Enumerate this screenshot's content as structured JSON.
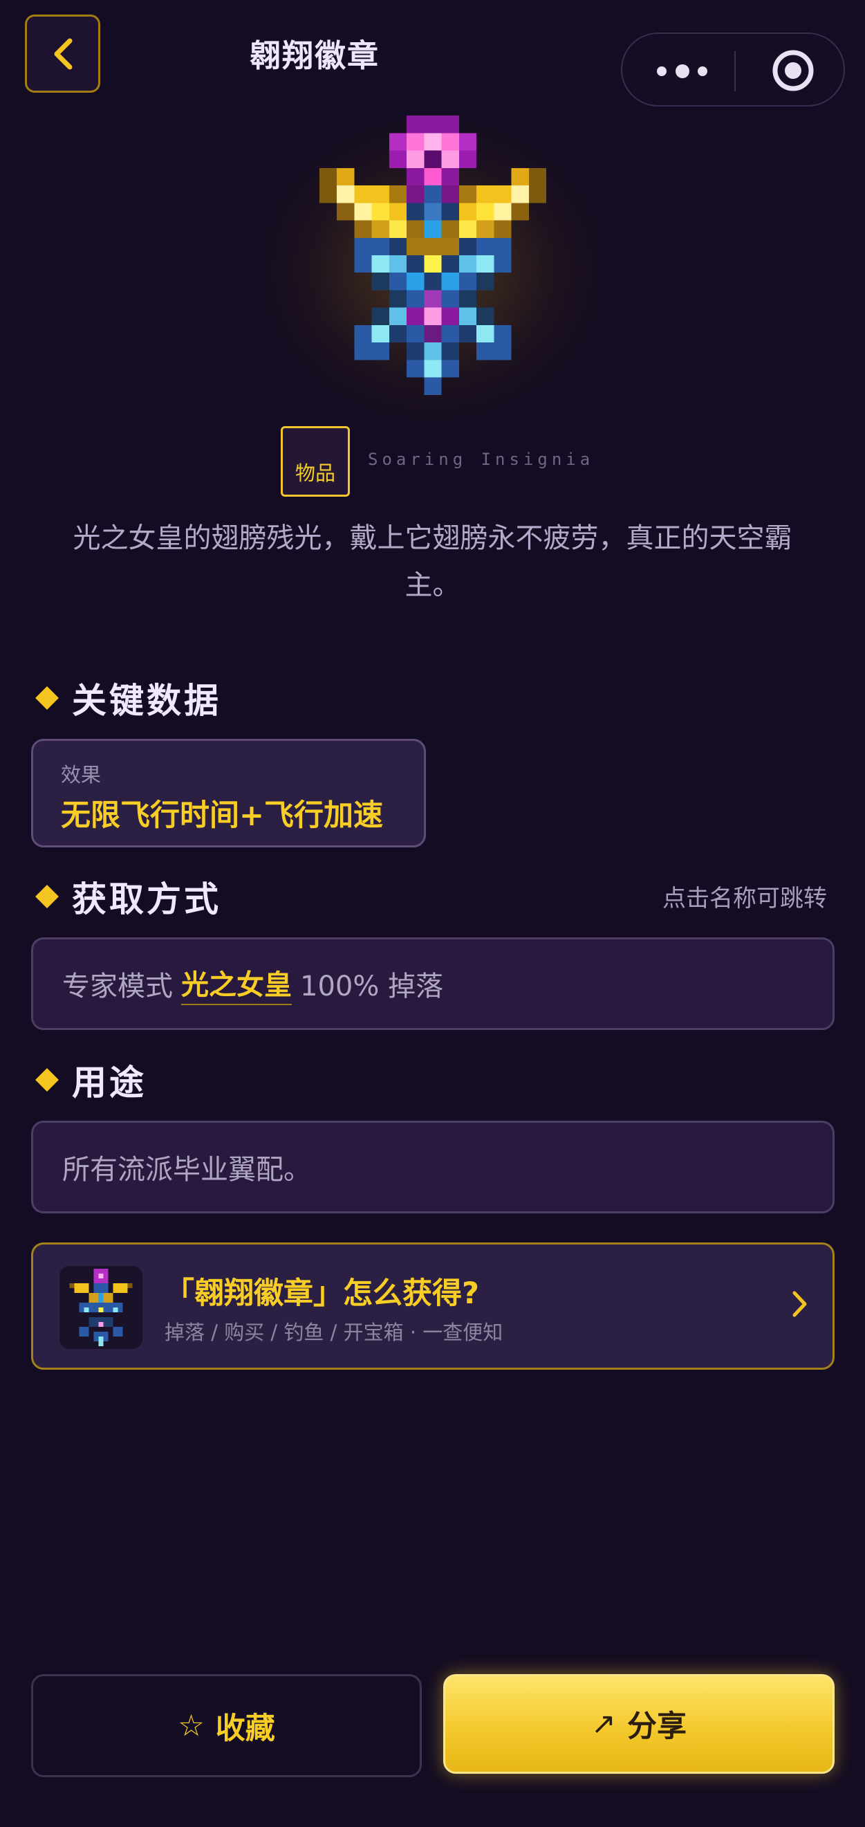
{
  "header": {
    "title": "翱翔徽章",
    "back_icon": "chevron-left-icon",
    "more_icon": "more-dots-icon",
    "close_icon": "target-circle-icon"
  },
  "item": {
    "category_badge": "物品",
    "english_name": "Soaring Insignia",
    "description": "光之女皇的翅膀残光，戴上它翅膀永不疲劳，真正的天空霸主。",
    "art_icon": "soaring-insignia-pixel-icon"
  },
  "key_data": {
    "section_title": "关键数据",
    "effect_label": "效果",
    "effect_value": "无限飞行时间+飞行加速"
  },
  "obtain": {
    "section_title": "获取方式",
    "hint": "点击名称可跳转",
    "mode": "专家模式",
    "boss": "光之女皇",
    "rate": "100% 掉落"
  },
  "usage": {
    "section_title": "用途",
    "text": "所有流派毕业翼配。"
  },
  "guide": {
    "title": "「翱翔徽章」怎么获得?",
    "subtitle": "掉落 / 购买 / 钓鱼 / 开宝箱 · 一查便知",
    "chevron_icon": "chevron-right-icon"
  },
  "actions": {
    "favorite_icon": "star-outline-icon",
    "favorite_label": "收藏",
    "share_icon": "share-arrow-icon",
    "share_label": "分享"
  },
  "colors": {
    "background": "#140c22",
    "accent_gold": "#f8cd25",
    "card": "#2c1f44"
  }
}
